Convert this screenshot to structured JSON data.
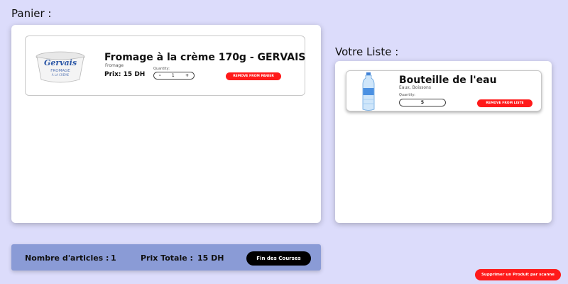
{
  "panier": {
    "title": "Panier :",
    "item": {
      "name": "Fromage à la crème 170g - GERVAIS",
      "category": "Fromage",
      "price": "Prix: 15 DH",
      "quantity_label": "Quantity:",
      "quantity": "1",
      "minus": "-",
      "plus": "+",
      "remove_label": "REMOVE FROM PANIER",
      "image_brand": "Gervais",
      "image_line1": "FROMAGE",
      "image_line2": "À LA CRÈME"
    }
  },
  "liste": {
    "title": "Votre Liste :",
    "item": {
      "name": "Bouteille de l'eau",
      "category": "Eaux, Boissons",
      "quantity_label": "Quantity:",
      "quantity": "5",
      "remove_label": "REMOVE FROM LISTE"
    }
  },
  "footer": {
    "articles_label": "Nombre d'articles :",
    "articles_value": "1",
    "total_label": "Prix Totale :",
    "total_value": "15 DH",
    "finish_label": "Fin des Courses"
  },
  "actions": {
    "delete_scanned_label": "Supprimer un Produit par scanne"
  },
  "colors": {
    "background": "#dcdcfb",
    "accent_red": "#ff1a1a",
    "footer_bar": "#8a9bd6"
  }
}
